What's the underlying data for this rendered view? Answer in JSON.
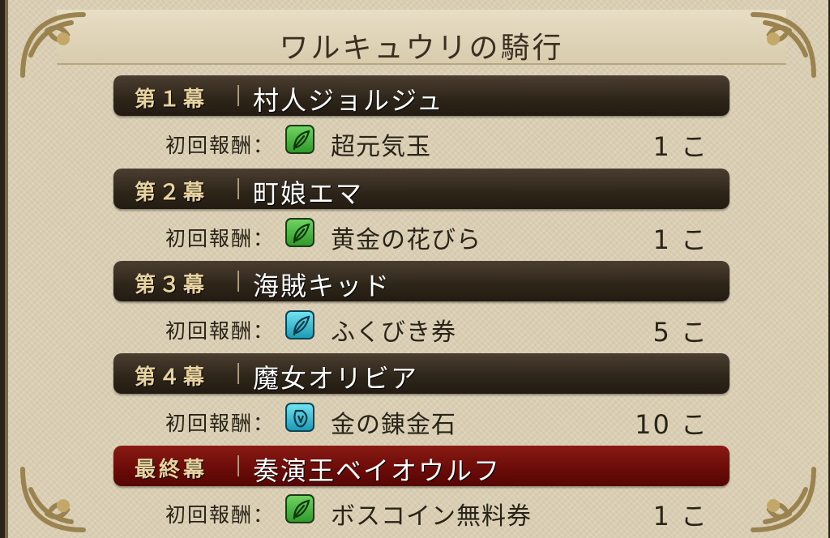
{
  "title": "ワルキュウリの騎行",
  "reward_label": "初回報酬：",
  "chapters": [
    {
      "label": "第１幕",
      "name": "村人ジョルジュ",
      "reward_item": "超元気玉",
      "reward_icon": "green-leaf-icon",
      "count": "1 こ"
    },
    {
      "label": "第２幕",
      "name": "町娘エマ",
      "reward_item": "黄金の花びら",
      "reward_icon": "green-leaf-icon",
      "count": "1 こ"
    },
    {
      "label": "第３幕",
      "name": "海賊キッド",
      "reward_item": "ふくびき券",
      "reward_icon": "blue-leaf-icon",
      "count": "5 こ"
    },
    {
      "label": "第４幕",
      "name": "魔女オリビア",
      "reward_item": "金の錬金石",
      "reward_icon": "blue-stone-icon",
      "count": "10 こ"
    },
    {
      "label": "最終幕",
      "name": "奏演王ベイオウルフ",
      "reward_item": "ボスコイン無料券",
      "reward_icon": "green-leaf-icon",
      "count": "1 こ"
    }
  ],
  "colors": {
    "chapter_bar": "#2e2519",
    "final_bar": "#6a0b08",
    "panel": "#ddd2b6"
  }
}
